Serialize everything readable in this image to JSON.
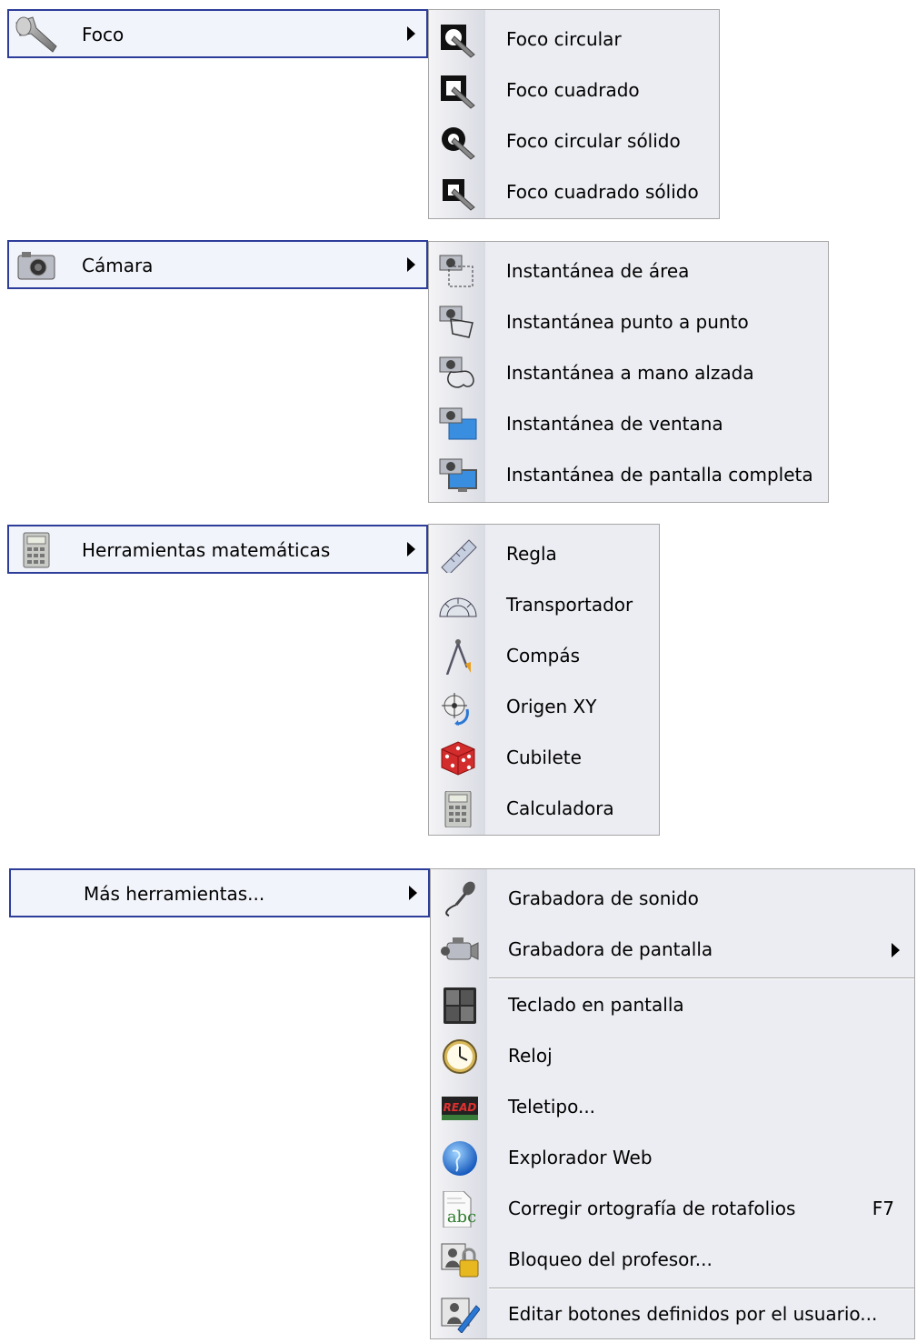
{
  "menus": [
    {
      "label": "Foco",
      "icon": "flashlight-icon",
      "items": [
        {
          "label": "Foco circular",
          "icon": "spotlight-circle-icon"
        },
        {
          "label": "Foco cuadrado",
          "icon": "spotlight-square-icon"
        },
        {
          "label": "Foco circular sólido",
          "icon": "spotlight-circle-solid-icon"
        },
        {
          "label": "Foco cuadrado sólido",
          "icon": "spotlight-square-solid-icon"
        }
      ]
    },
    {
      "label": "Cámara",
      "icon": "camera-icon",
      "items": [
        {
          "label": "Instantánea de área",
          "icon": "area-capture-icon"
        },
        {
          "label": "Instantánea punto a punto",
          "icon": "point-capture-icon"
        },
        {
          "label": "Instantánea a mano alzada",
          "icon": "freehand-capture-icon"
        },
        {
          "label": "Instantánea de ventana",
          "icon": "window-capture-icon"
        },
        {
          "label": "Instantánea de pantalla completa",
          "icon": "fullscreen-capture-icon"
        }
      ]
    },
    {
      "label": "Herramientas matemáticas",
      "icon": "calculator-icon",
      "items": [
        {
          "label": "Regla",
          "icon": "ruler-icon"
        },
        {
          "label": "Transportador",
          "icon": "protractor-icon"
        },
        {
          "label": "Compás",
          "icon": "compass-icon"
        },
        {
          "label": "Origen XY",
          "icon": "xy-origin-icon"
        },
        {
          "label": "Cubilete",
          "icon": "dice-icon"
        },
        {
          "label": "Calculadora",
          "icon": "calculator-icon"
        }
      ]
    },
    {
      "label": "Más herramientas...",
      "icon": "",
      "items": [
        {
          "label": "Grabadora de sonido",
          "icon": "microphone-icon"
        },
        {
          "label": "Grabadora de pantalla",
          "icon": "video-camera-icon",
          "submenu": true
        },
        {
          "label": "Teclado en pantalla",
          "icon": "keypad-icon"
        },
        {
          "label": "Reloj",
          "icon": "clock-icon"
        },
        {
          "label": "Teletipo...",
          "icon": "ticker-icon",
          "icon_text": "READ"
        },
        {
          "label": "Explorador Web",
          "icon": "globe-icon"
        },
        {
          "label": "Corregir ortografía de rotafolios",
          "icon": "spellcheck-icon",
          "shortcut": "F7",
          "icon_text": "abc"
        },
        {
          "label": "Bloqueo del profesor...",
          "icon": "teacher-lock-icon"
        },
        {
          "label": "Editar botones definidos por el usuario...",
          "icon": "edit-buttons-icon"
        }
      ]
    }
  ],
  "colors": {
    "highlight_border": "#2d3d9a",
    "highlight_fill": "#f2f4fb",
    "menu_bg": "#ecedf2",
    "menu_border": "#a6a6a6"
  }
}
